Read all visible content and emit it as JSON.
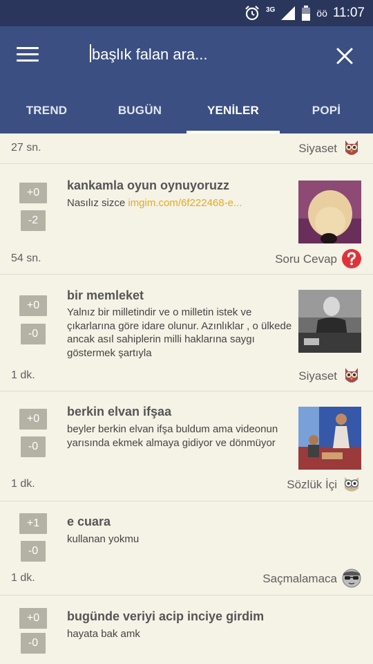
{
  "status_bar": {
    "network": "3G",
    "operator": "öö",
    "time": "11:07"
  },
  "toolbar": {
    "search_text": "başlık falan ara...",
    "menu_icon": "hamburger-menu-icon",
    "close_icon": "close-icon",
    "color": "#3b4f82"
  },
  "tabs": [
    {
      "label": "TREND"
    },
    {
      "label": "BUGÜN"
    },
    {
      "label": "YENİLER",
      "active": true
    },
    {
      "label": "POPİ"
    }
  ],
  "previous_post": {
    "time": "27 sn.",
    "category": "Siyaset",
    "category_icon": "owl-red-icon"
  },
  "posts": [
    {
      "up": "+0",
      "down": "-2",
      "title": "kankamla oyun oynuyoruzz",
      "body": "Nasılız sizce ",
      "link": "imgim.com/6f222468-e...",
      "time": "54 sn.",
      "category": "Soru Cevap",
      "category_icon": "question-icon"
    },
    {
      "up": "+0",
      "down": "-0",
      "title": "bir memleket",
      "body": "Yalnız bir milletindir ve o milletin istek ve çıkarlarına göre idare olunur. Azınlıklar , o ülkede ancak asıl sahiplerin milli haklarına saygı göstermek şartıyla",
      "time": "1 dk.",
      "category": "Siyaset",
      "category_icon": "owl-red-icon"
    },
    {
      "up": "+0",
      "down": "-0",
      "title": "berkin elvan ifşaa",
      "body": "beyler berkin elvan ifşa buldum ama videonun yarısında ekmek almaya gidiyor ve dönmüyor",
      "time": "1 dk.",
      "category": "Sözlük İçi",
      "category_icon": "owl-beige-icon"
    },
    {
      "up": "+1",
      "down": "-0",
      "title": "e cuara",
      "body": "kullanan yokmu",
      "time": "1 dk.",
      "category": "Saçmalamaca",
      "category_icon": "sunglasses-face-icon"
    },
    {
      "up": "+0",
      "down": "-0",
      "title": "bugünde veriyi acip inciye girdim",
      "body": "hayata bak amk"
    }
  ]
}
